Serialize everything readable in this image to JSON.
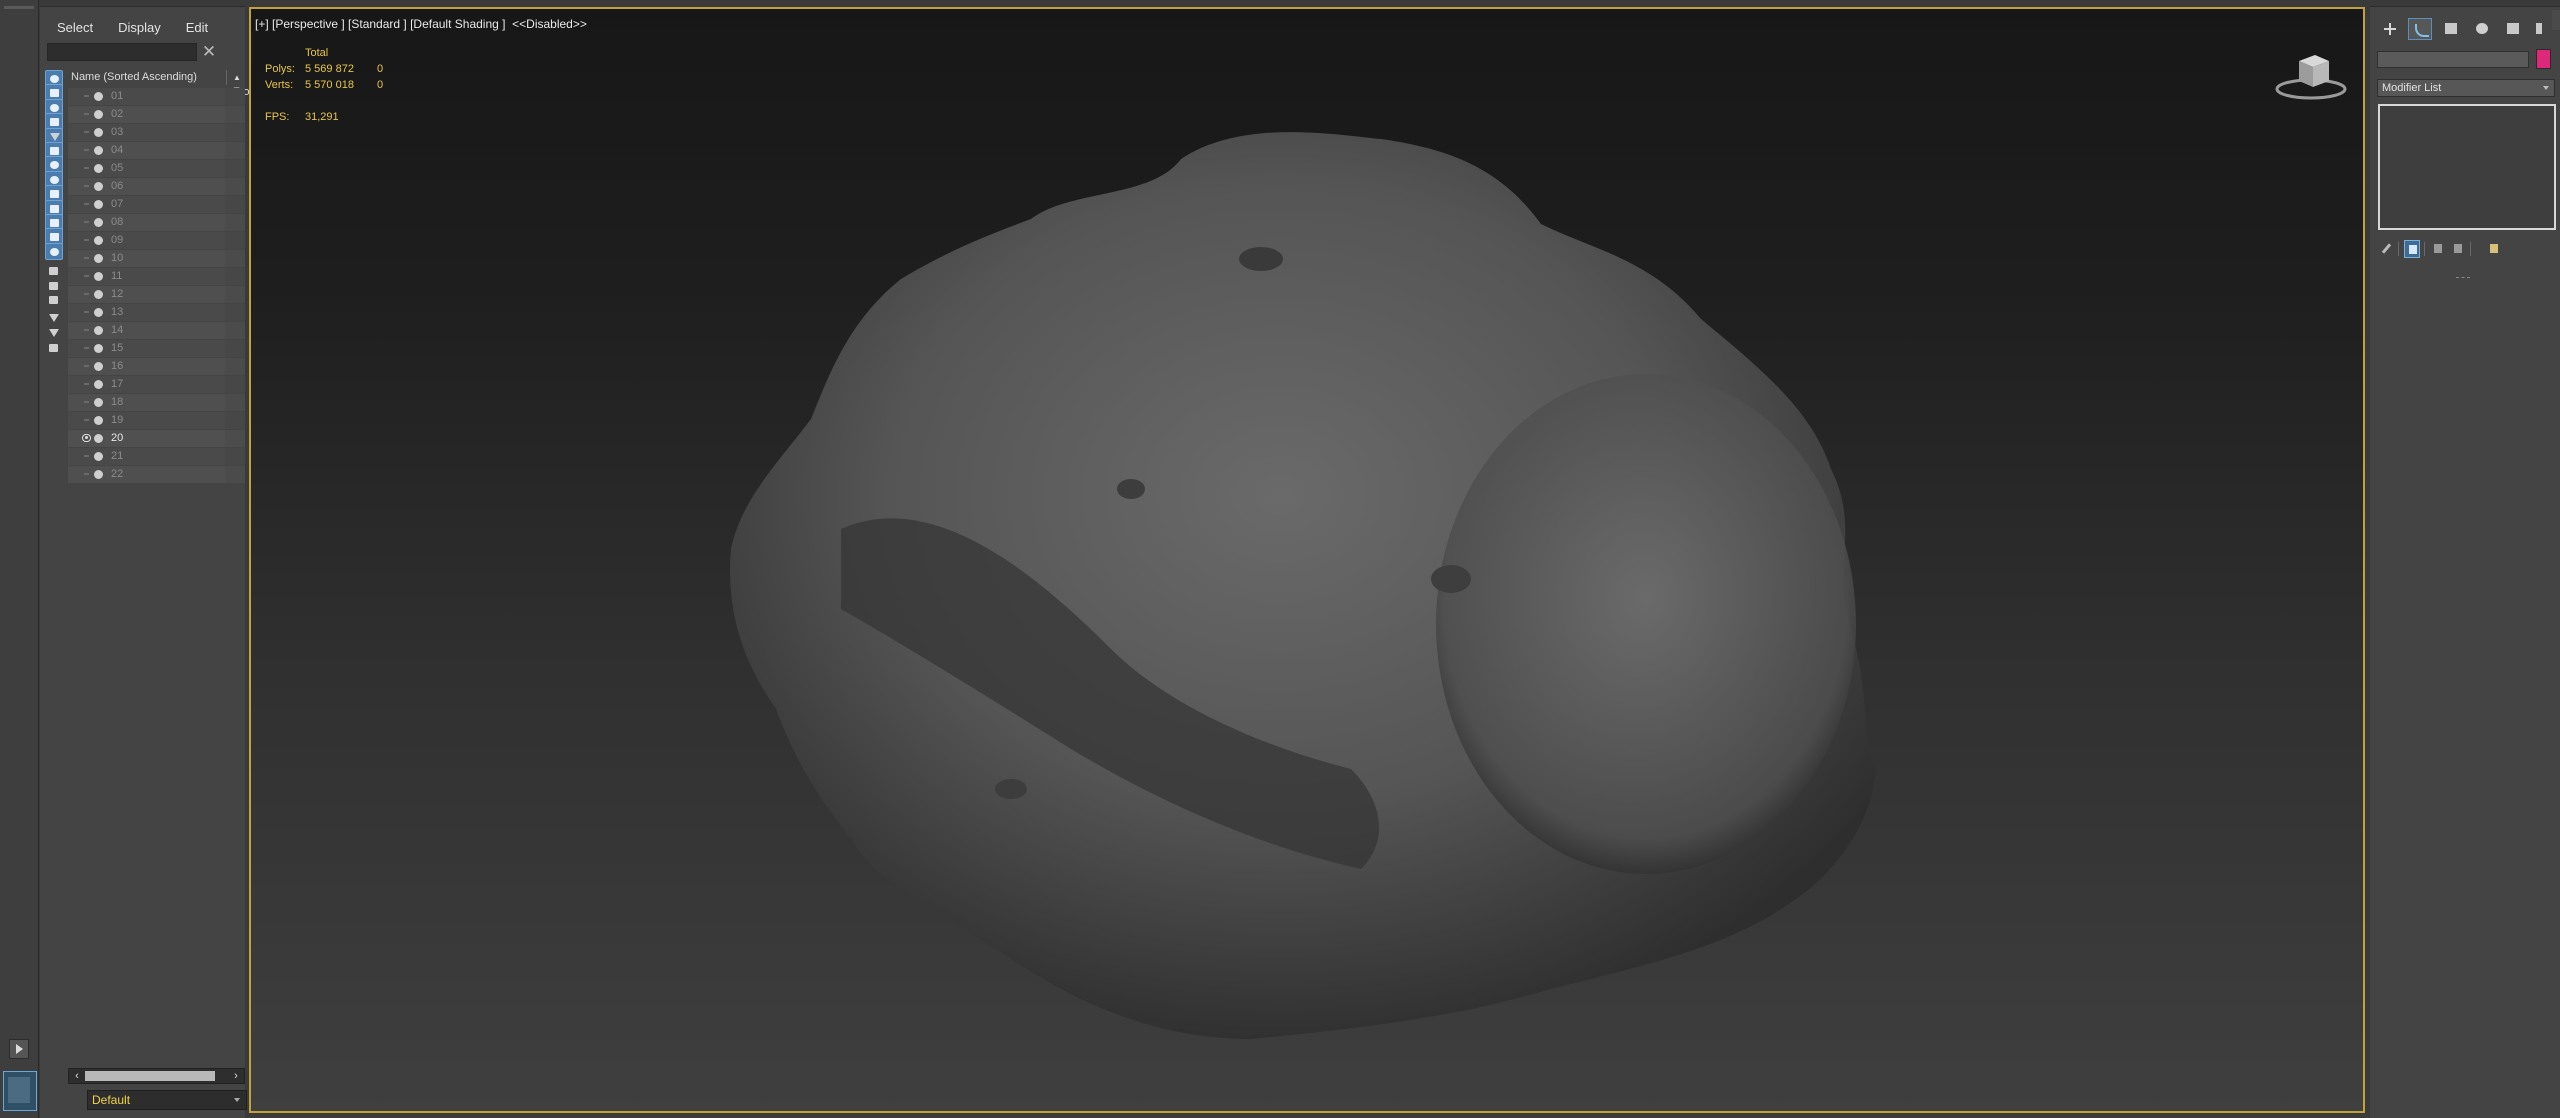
{
  "explorer": {
    "menu": [
      "Select",
      "Display",
      "Edit"
    ],
    "search": {
      "value": "",
      "placeholder": ""
    },
    "columns": {
      "name": "Name (Sorted Ascending)",
      "sort_glyph": "▲",
      "frozen": "Froze"
    },
    "layers": [
      {
        "label": "01",
        "visible": false
      },
      {
        "label": "02",
        "visible": false
      },
      {
        "label": "03",
        "visible": false
      },
      {
        "label": "04",
        "visible": false
      },
      {
        "label": "05",
        "visible": false
      },
      {
        "label": "06",
        "visible": false
      },
      {
        "label": "07",
        "visible": false
      },
      {
        "label": "08",
        "visible": false
      },
      {
        "label": "09",
        "visible": false
      },
      {
        "label": "10",
        "visible": false
      },
      {
        "label": "11",
        "visible": false
      },
      {
        "label": "12",
        "visible": false
      },
      {
        "label": "13",
        "visible": false
      },
      {
        "label": "14",
        "visible": false
      },
      {
        "label": "15",
        "visible": false
      },
      {
        "label": "16",
        "visible": false
      },
      {
        "label": "17",
        "visible": false
      },
      {
        "label": "18",
        "visible": false
      },
      {
        "label": "19",
        "visible": false
      },
      {
        "label": "20",
        "visible": true
      },
      {
        "label": "21",
        "visible": false
      },
      {
        "label": "22",
        "visible": false
      }
    ],
    "tool_icons": [
      {
        "name": "display-geometry-icon",
        "on": true
      },
      {
        "name": "display-shapes-icon",
        "on": true
      },
      {
        "name": "display-lights-icon",
        "on": true
      },
      {
        "name": "display-cameras-icon",
        "on": true
      },
      {
        "name": "display-helpers-icon",
        "on": true
      },
      {
        "name": "display-spacewarps-icon",
        "on": true
      },
      {
        "name": "display-groups-icon",
        "on": true
      },
      {
        "name": "display-xrefs-icon",
        "on": true
      },
      {
        "name": "display-bones-icon",
        "on": true
      },
      {
        "name": "display-containers-icon",
        "on": true
      },
      {
        "name": "display-frozen-icon",
        "on": true
      },
      {
        "name": "display-hidden-icon",
        "on": true
      },
      {
        "name": "display-all-icon",
        "on": true
      },
      {
        "name": "display-none-icon",
        "on": false
      },
      {
        "name": "display-invert-icon",
        "on": false
      },
      {
        "name": "display-children-icon",
        "on": false
      },
      {
        "name": "filter-funnel-icon",
        "on": false
      },
      {
        "name": "filter-icon",
        "on": false
      },
      {
        "name": "layer-manager-icon",
        "on": false
      }
    ],
    "layer_dropdown": "Default"
  },
  "viewport": {
    "label": "[+] [Perspective ] [Standard ] [Default Shading ]  <<Disabled>>",
    "stats": {
      "header": "Total",
      "polys_label": "Polys:",
      "polys_total": "5 569 872",
      "polys_selected": "0",
      "verts_label": "Verts:",
      "verts_total": "5 570 018",
      "verts_selected": "0",
      "fps_label": "FPS:",
      "fps_value": "31,291"
    }
  },
  "command_panel": {
    "tabs": [
      {
        "name": "create-tab-icon",
        "active": false
      },
      {
        "name": "modify-tab-icon",
        "active": true
      },
      {
        "name": "hierarchy-tab-icon",
        "active": false
      },
      {
        "name": "motion-tab-icon",
        "active": false
      },
      {
        "name": "display-tab-icon",
        "active": false
      }
    ],
    "object_name": "",
    "object_color": "#e0287a",
    "modifier_list": "Modifier List"
  },
  "colors": {
    "viewport_border": "#c4a23a",
    "stats_text": "#e8c64a",
    "accent_blue": "#4a7dad"
  }
}
